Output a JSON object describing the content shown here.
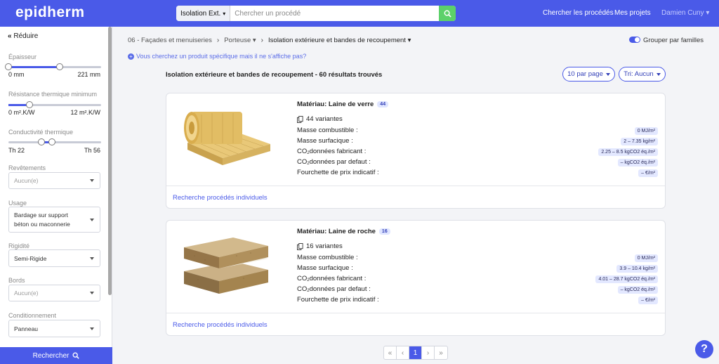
{
  "header": {
    "logo": "epidherm",
    "search_type": "Isolation Ext.",
    "search_placeholder": "Chercher un procédé",
    "nav_search": "Chercher les procédés",
    "nav_projects": "Mes projets",
    "user": "Damien Cuny"
  },
  "sidebar": {
    "collapse_label": "Réduire",
    "epaisseur": {
      "label": "Épaisseur",
      "min": "0 mm",
      "max": "221 mm",
      "low_fraction": 0.0,
      "high_fraction": 0.55
    },
    "resistance": {
      "label": "Résistance thermique minimum",
      "min": "0 m².K/W",
      "max": "12 m².K/W",
      "value_fraction": 0.22
    },
    "conductivite": {
      "label": "Conductivité thermique",
      "min": "Th 22",
      "max": "Th 56",
      "low_fraction": 0.35,
      "high_fraction": 0.47
    },
    "revetements": {
      "label": "Revêtements",
      "value": "Aucun(e)"
    },
    "usage": {
      "label": "Usage",
      "value_line1": "Bardage sur support",
      "value_line2": "béton ou maconnerie"
    },
    "rigidite": {
      "label": "Rigidité",
      "value": "Semi-Rigide"
    },
    "bords": {
      "label": "Bords",
      "value": "Aucun(e)"
    },
    "conditionnement": {
      "label": "Conditionnement",
      "value": "Panneau"
    },
    "search_button": "Rechercher"
  },
  "breadcrumb": {
    "item1": "06 - Façades et menuiseries",
    "item2": "Porteuse",
    "item3": "Isolation extérieure et bandes de recoupement"
  },
  "group_toggle": {
    "label": "Grouper par familles",
    "on": true
  },
  "hint": "Vous cherchez un produit spécifique mais il ne s'affiche pas?",
  "results": {
    "title": "Isolation extérieure et bandes de recoupement - 60 résultats trouvés",
    "per_page": "10 par page",
    "sort": "Tri: Aucun"
  },
  "labels": {
    "masse_combustible": "Masse combustible :",
    "masse_surfacique": "Masse surfacique :",
    "co2_fab_pre": "CO",
    "co2_fab_sub": "2",
    "co2_fab_post": "données fabricant :",
    "co2_def_post": "données par defaut :",
    "prix": "Fourchette de prix indicatif :",
    "link": "Recherche procédés individuels"
  },
  "cards": [
    {
      "material": "Matériau: Laine de verre",
      "count": "44",
      "variants": "44 variantes",
      "masse_combustible": "0 MJ/m²",
      "masse_surfacique": "2 – 7.35 kg/m²",
      "co2_fabricant": "2.25 – 8.5 kgCO2 éq./m²",
      "co2_defaut": "– kgCO2 éq./m²",
      "prix": "– €/m²"
    },
    {
      "material": "Matériau: Laine de roche",
      "count": "16",
      "variants": "16 variantes",
      "masse_combustible": "0 MJ/m²",
      "masse_surfacique": "3.9 – 10.4 kg/m²",
      "co2_fabricant": "4.01 – 28.7 kgCO2 éq./m²",
      "co2_defaut": "– kgCO2 éq./m²",
      "prix": "– €/m²"
    }
  ],
  "pagination": {
    "first": "«",
    "prev": "‹",
    "current": "1",
    "next": "›",
    "last": "»"
  },
  "help": "?",
  "colors": {
    "primary": "#4a5ae8",
    "search_green": "#5cd16a"
  }
}
